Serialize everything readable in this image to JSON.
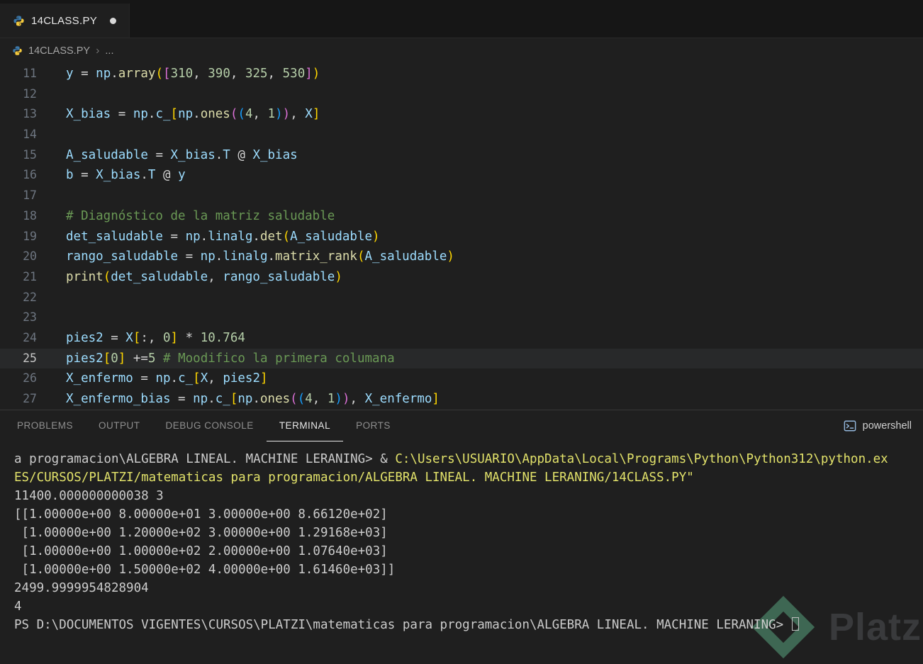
{
  "tab_bar": {
    "tabs": [
      {
        "title": "14CLASS.PY",
        "modified": true,
        "active": true
      }
    ]
  },
  "breadcrumb": {
    "file": "14CLASS.PY",
    "separator": "›",
    "ellipsis": "..."
  },
  "editor": {
    "token_colors": {
      "v": "#9cdcfe",
      "f": "#dcdcaa",
      "n": "#b5cea8",
      "c": "#6a9955",
      "w": "#d4d4d4",
      "b1": "#ffd700",
      "b2": "#da70d6",
      "b3": "#179fff"
    },
    "lines": [
      {
        "num": "11",
        "tokens": [
          {
            "t": "y",
            "c": "v"
          },
          {
            "t": " = ",
            "c": "w"
          },
          {
            "t": "np",
            "c": "v"
          },
          {
            "t": ".",
            "c": "w"
          },
          {
            "t": "array",
            "c": "f"
          },
          {
            "t": "(",
            "c": "b1"
          },
          {
            "t": "[",
            "c": "b2"
          },
          {
            "t": "310",
            "c": "n"
          },
          {
            "t": ", ",
            "c": "w"
          },
          {
            "t": "390",
            "c": "n"
          },
          {
            "t": ", ",
            "c": "w"
          },
          {
            "t": "325",
            "c": "n"
          },
          {
            "t": ", ",
            "c": "w"
          },
          {
            "t": "530",
            "c": "n"
          },
          {
            "t": "]",
            "c": "b2"
          },
          {
            "t": ")",
            "c": "b1"
          }
        ]
      },
      {
        "num": "12",
        "tokens": []
      },
      {
        "num": "13",
        "tokens": [
          {
            "t": "X_bias",
            "c": "v"
          },
          {
            "t": " = ",
            "c": "w"
          },
          {
            "t": "np",
            "c": "v"
          },
          {
            "t": ".",
            "c": "w"
          },
          {
            "t": "c_",
            "c": "v"
          },
          {
            "t": "[",
            "c": "b1"
          },
          {
            "t": "np",
            "c": "v"
          },
          {
            "t": ".",
            "c": "w"
          },
          {
            "t": "ones",
            "c": "f"
          },
          {
            "t": "(",
            "c": "b2"
          },
          {
            "t": "(",
            "c": "b3"
          },
          {
            "t": "4",
            "c": "n"
          },
          {
            "t": ", ",
            "c": "w"
          },
          {
            "t": "1",
            "c": "n"
          },
          {
            "t": ")",
            "c": "b3"
          },
          {
            "t": ")",
            "c": "b2"
          },
          {
            "t": ", ",
            "c": "w"
          },
          {
            "t": "X",
            "c": "v"
          },
          {
            "t": "]",
            "c": "b1"
          }
        ]
      },
      {
        "num": "14",
        "tokens": []
      },
      {
        "num": "15",
        "tokens": [
          {
            "t": "A_saludable",
            "c": "v"
          },
          {
            "t": " = ",
            "c": "w"
          },
          {
            "t": "X_bias",
            "c": "v"
          },
          {
            "t": ".",
            "c": "w"
          },
          {
            "t": "T",
            "c": "v"
          },
          {
            "t": " @ ",
            "c": "w"
          },
          {
            "t": "X_bias",
            "c": "v"
          }
        ]
      },
      {
        "num": "16",
        "tokens": [
          {
            "t": "b",
            "c": "v"
          },
          {
            "t": " = ",
            "c": "w"
          },
          {
            "t": "X_bias",
            "c": "v"
          },
          {
            "t": ".",
            "c": "w"
          },
          {
            "t": "T",
            "c": "v"
          },
          {
            "t": " @ ",
            "c": "w"
          },
          {
            "t": "y",
            "c": "v"
          }
        ]
      },
      {
        "num": "17",
        "tokens": []
      },
      {
        "num": "18",
        "tokens": [
          {
            "t": "# Diagnóstico de la matriz saludable",
            "c": "c"
          }
        ]
      },
      {
        "num": "19",
        "tokens": [
          {
            "t": "det_saludable",
            "c": "v"
          },
          {
            "t": " = ",
            "c": "w"
          },
          {
            "t": "np",
            "c": "v"
          },
          {
            "t": ".",
            "c": "w"
          },
          {
            "t": "linalg",
            "c": "v"
          },
          {
            "t": ".",
            "c": "w"
          },
          {
            "t": "det",
            "c": "f"
          },
          {
            "t": "(",
            "c": "b1"
          },
          {
            "t": "A_saludable",
            "c": "v"
          },
          {
            "t": ")",
            "c": "b1"
          }
        ]
      },
      {
        "num": "20",
        "tokens": [
          {
            "t": "rango_saludable",
            "c": "v"
          },
          {
            "t": " = ",
            "c": "w"
          },
          {
            "t": "np",
            "c": "v"
          },
          {
            "t": ".",
            "c": "w"
          },
          {
            "t": "linalg",
            "c": "v"
          },
          {
            "t": ".",
            "c": "w"
          },
          {
            "t": "matrix_rank",
            "c": "f"
          },
          {
            "t": "(",
            "c": "b1"
          },
          {
            "t": "A_saludable",
            "c": "v"
          },
          {
            "t": ")",
            "c": "b1"
          }
        ]
      },
      {
        "num": "21",
        "tokens": [
          {
            "t": "print",
            "c": "f"
          },
          {
            "t": "(",
            "c": "b1"
          },
          {
            "t": "det_saludable",
            "c": "v"
          },
          {
            "t": ", ",
            "c": "w"
          },
          {
            "t": "rango_saludable",
            "c": "v"
          },
          {
            "t": ")",
            "c": "b1"
          }
        ]
      },
      {
        "num": "22",
        "tokens": []
      },
      {
        "num": "23",
        "tokens": []
      },
      {
        "num": "24",
        "tokens": [
          {
            "t": "pies2",
            "c": "v"
          },
          {
            "t": " = ",
            "c": "w"
          },
          {
            "t": "X",
            "c": "v"
          },
          {
            "t": "[",
            "c": "b1"
          },
          {
            "t": ":, ",
            "c": "w"
          },
          {
            "t": "0",
            "c": "n"
          },
          {
            "t": "]",
            "c": "b1"
          },
          {
            "t": " * ",
            "c": "w"
          },
          {
            "t": "10.764",
            "c": "n"
          }
        ]
      },
      {
        "num": "25",
        "current": true,
        "tokens": [
          {
            "t": "pies2",
            "c": "v"
          },
          {
            "t": "[",
            "c": "b1"
          },
          {
            "t": "0",
            "c": "n"
          },
          {
            "t": "]",
            "c": "b1"
          },
          {
            "t": " +=",
            "c": "w"
          },
          {
            "t": "5",
            "c": "n"
          },
          {
            "t": " ",
            "c": "w"
          },
          {
            "t": "# Moodifico la primera columana",
            "c": "c"
          }
        ]
      },
      {
        "num": "26",
        "tokens": [
          {
            "t": "X_enfermo",
            "c": "v"
          },
          {
            "t": " = ",
            "c": "w"
          },
          {
            "t": "np",
            "c": "v"
          },
          {
            "t": ".",
            "c": "w"
          },
          {
            "t": "c_",
            "c": "v"
          },
          {
            "t": "[",
            "c": "b1"
          },
          {
            "t": "X",
            "c": "v"
          },
          {
            "t": ", ",
            "c": "w"
          },
          {
            "t": "pies2",
            "c": "v"
          },
          {
            "t": "]",
            "c": "b1"
          }
        ]
      },
      {
        "num": "27",
        "tokens": [
          {
            "t": "X_enfermo_bias",
            "c": "v"
          },
          {
            "t": " = ",
            "c": "w"
          },
          {
            "t": "np",
            "c": "v"
          },
          {
            "t": ".",
            "c": "w"
          },
          {
            "t": "c_",
            "c": "v"
          },
          {
            "t": "[",
            "c": "b1"
          },
          {
            "t": "np",
            "c": "v"
          },
          {
            "t": ".",
            "c": "w"
          },
          {
            "t": "ones",
            "c": "f"
          },
          {
            "t": "(",
            "c": "b2"
          },
          {
            "t": "(",
            "c": "b3"
          },
          {
            "t": "4",
            "c": "n"
          },
          {
            "t": ", ",
            "c": "w"
          },
          {
            "t": "1",
            "c": "n"
          },
          {
            "t": ")",
            "c": "b3"
          },
          {
            "t": ")",
            "c": "b2"
          },
          {
            "t": ", ",
            "c": "w"
          },
          {
            "t": "X_enfermo",
            "c": "v"
          },
          {
            "t": "]",
            "c": "b1"
          }
        ]
      }
    ]
  },
  "panel": {
    "tabs": [
      {
        "label": "PROBLEMS"
      },
      {
        "label": "OUTPUT"
      },
      {
        "label": "DEBUG CONSOLE"
      },
      {
        "label": "TERMINAL",
        "active": true
      },
      {
        "label": "PORTS"
      }
    ],
    "shell_label": "powershell"
  },
  "terminal": {
    "colors": {
      "default": "#cccccc",
      "yellow": "#e2e26a"
    },
    "lines": [
      {
        "segments": [
          {
            "text": "a programacion\\ALGEBRA LINEAL. MACHINE LERANING> & ",
            "color": "default"
          },
          {
            "text": "C:\\Users\\USUARIO\\AppData\\Local\\Programs\\Python\\Python312\\python.ex",
            "color": "yellow"
          }
        ]
      },
      {
        "segments": [
          {
            "text": "ES/CURSOS/PLATZI/matematicas para programacion/ALGEBRA LINEAL. MACHINE LERANING/14CLASS.PY\"",
            "color": "yellow"
          }
        ]
      },
      {
        "segments": [
          {
            "text": "11400.000000000038 3",
            "color": "default"
          }
        ]
      },
      {
        "segments": [
          {
            "text": "[[1.00000e+00 8.00000e+01 3.00000e+00 8.66120e+02]",
            "color": "default"
          }
        ]
      },
      {
        "segments": [
          {
            "text": " [1.00000e+00 1.20000e+02 3.00000e+00 1.29168e+03]",
            "color": "default"
          }
        ]
      },
      {
        "segments": [
          {
            "text": " [1.00000e+00 1.00000e+02 2.00000e+00 1.07640e+03]",
            "color": "default"
          }
        ]
      },
      {
        "segments": [
          {
            "text": " [1.00000e+00 1.50000e+02 4.00000e+00 1.61460e+03]]",
            "color": "default"
          }
        ]
      },
      {
        "segments": [
          {
            "text": "2499.9999954828904",
            "color": "default"
          }
        ]
      },
      {
        "segments": [
          {
            "text": "4",
            "color": "default"
          }
        ]
      },
      {
        "segments": [
          {
            "text": "PS D:\\DOCUMENTOS VIGENTES\\CURSOS\\PLATZI\\matematicas para programacion\\ALGEBRA LINEAL. MACHINE LERANING> ",
            "color": "default"
          }
        ],
        "cursor": true
      }
    ]
  },
  "watermark": {
    "text": "Platzi",
    "logo_color": "#58a37d"
  }
}
